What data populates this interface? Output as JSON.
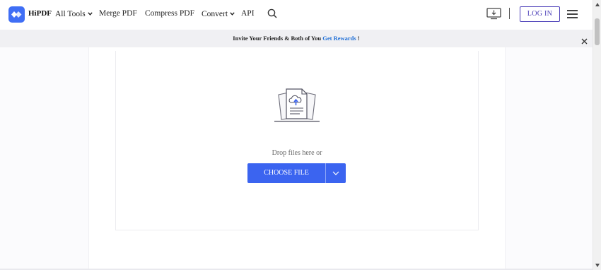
{
  "header": {
    "brand": "HiPDF",
    "logo_icon": "hipdf-logo-icon",
    "nav": {
      "all_tools": "All Tools",
      "merge_pdf": "Merge PDF",
      "compress_pdf": "Compress PDF",
      "convert": "Convert",
      "api": "API"
    },
    "login_label": "LOG IN"
  },
  "banner": {
    "text_before": "Invite Your Friends & Both of You ",
    "link_text": "Get Rewards",
    "text_after": " !"
  },
  "upload": {
    "drop_text": "Drop files here or",
    "choose_label": "CHOOSE FILE"
  },
  "colors": {
    "accent": "#3b64f0",
    "login_border": "#4b3fb8",
    "banner_bg": "#f0f0f3",
    "link": "#1f6fd6"
  }
}
